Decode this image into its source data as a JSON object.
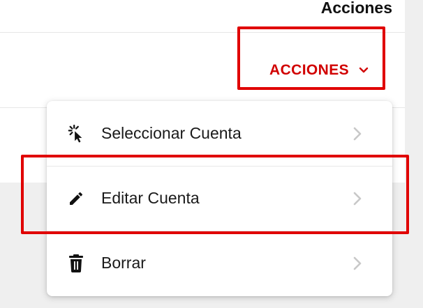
{
  "header": {
    "actions_column_label": "Acciones"
  },
  "row": {
    "actions_button_label": "ACCIONES"
  },
  "menu": {
    "items": [
      {
        "label": "Seleccionar Cuenta",
        "icon": "cursor-click-icon"
      },
      {
        "label": "Editar Cuenta",
        "icon": "pencil-icon"
      },
      {
        "label": "Borrar",
        "icon": "trash-icon"
      }
    ]
  },
  "colors": {
    "accent": "#d10000",
    "highlight": "#e00000",
    "chevron": "#c8c8c8"
  }
}
